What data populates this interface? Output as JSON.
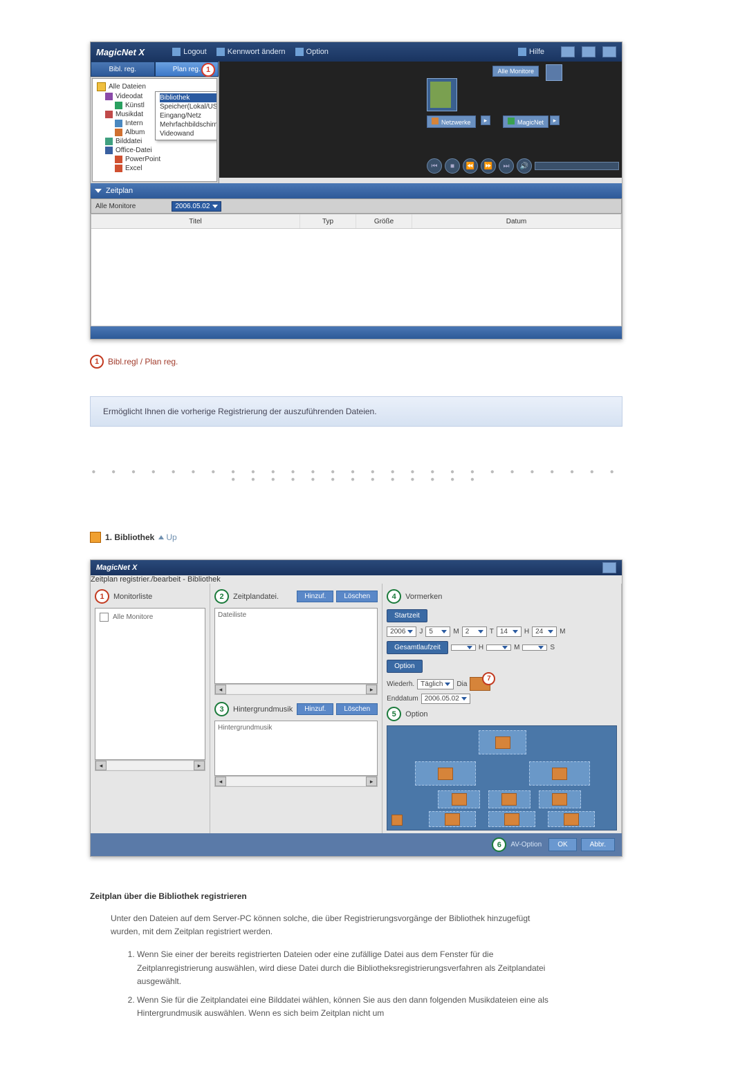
{
  "app1": {
    "logo": "MagicNet X",
    "toolbar": {
      "logout": "Logout",
      "kennwort": "Kennwort ändern",
      "option": "Option",
      "hilfe": "Hilfe"
    },
    "side_tabs": {
      "bibl": "Bibl. reg.",
      "plan": "Plan reg."
    },
    "badge1": "1",
    "tree": {
      "alle": "Alle Dateien",
      "video": "Videodat",
      "kunst": "Künstl",
      "musik": "Musikdat",
      "inter": "Intern",
      "album": "Album",
      "bild": "Bilddatei",
      "office": "Office-Datei",
      "ppt": "PowerPoint",
      "excel": "Excel"
    },
    "popup": {
      "bibliothek": "Bibliothek",
      "speicher": "Speicher(Lokal/USB)",
      "eingang": "Eingang/Netz",
      "mehrfach": "Mehrfachbildschirm",
      "videowand": "Videowand"
    },
    "preview": {
      "alle_mon": "Alle Monitore",
      "netzwerke": "Netzwerke",
      "magicnet": "MagicNet"
    },
    "zeitplan": "Zeitplan",
    "alle_mon_label": "Alle Monitore",
    "date_combo": "2006.05.02",
    "grid": {
      "titel": "Titel",
      "typ": "Typ",
      "grosse": "Größe",
      "datum": "Datum"
    }
  },
  "legend1": {
    "num": "1",
    "text": "Bibl.regl / Plan reg."
  },
  "info_bar": "Ermöglicht Ihnen die vorherige Registrierung der auszuführenden Dateien.",
  "section": {
    "title": "1. Bibliothek",
    "up": "Up"
  },
  "app2": {
    "logo": "MagicNet X",
    "subtitle": "Zeitplan registrier./bearbeit - Bibliothek",
    "col1": {
      "num": "1",
      "title": "Monitorliste",
      "row": "Alle Monitore"
    },
    "col2": {
      "numA": "2",
      "titleA": "Zeitplandatei.",
      "hinzuf": "Hinzuf.",
      "loeschen": "Löschen",
      "listA": "Dateiliste",
      "numB": "3",
      "titleB": "Hintergrundmusik",
      "listB": "Hintergrundmusik"
    },
    "col3": {
      "num": "4",
      "title": "Vormerken",
      "startzeit": "Startzeit",
      "y": "2006",
      "mo": "5",
      "d": "2",
      "h": "14",
      "mi": "24",
      "lbl_j": "J",
      "lbl_m": "M",
      "lbl_t": "T",
      "lbl_h": "H",
      "lbl_mi": "M",
      "gesamt": "Gesamtlaufzeit",
      "g_h": "H",
      "g_m": "M",
      "g_s": "S",
      "option": "Option",
      "wiederh": "Wiederh.",
      "taglich": "Täglich",
      "dia": "Dia",
      "num7": "7",
      "enddatum": "Enddatum",
      "enddate": "2006.05.02",
      "num5": "5",
      "option2": "Option"
    },
    "footer": {
      "num": "6",
      "av": "AV-Option",
      "ok": "OK",
      "abbr": "Abbr."
    }
  },
  "body": {
    "h": "Zeitplan über die Bibliothek registrieren",
    "p": "Unter den Dateien auf dem Server-PC können solche, die über Registrierungsvorgänge der Bibliothek hinzugefügt wurden, mit dem Zeitplan registriert werden.",
    "li1": "Wenn Sie einer der bereits registrierten Dateien oder eine zufällige Datei aus dem Fenster für die Zeitplanregistrierung auswählen, wird diese Datei durch die Bibliotheksregistrierungsverfahren als Zeitplandatei ausgewählt.",
    "li2": "Wenn Sie für die Zeitplandatei eine Bilddatei wählen, können Sie aus den dann folgenden Musikdateien eine als Hintergrundmusik auswählen. Wenn es sich beim Zeitplan nicht um"
  }
}
